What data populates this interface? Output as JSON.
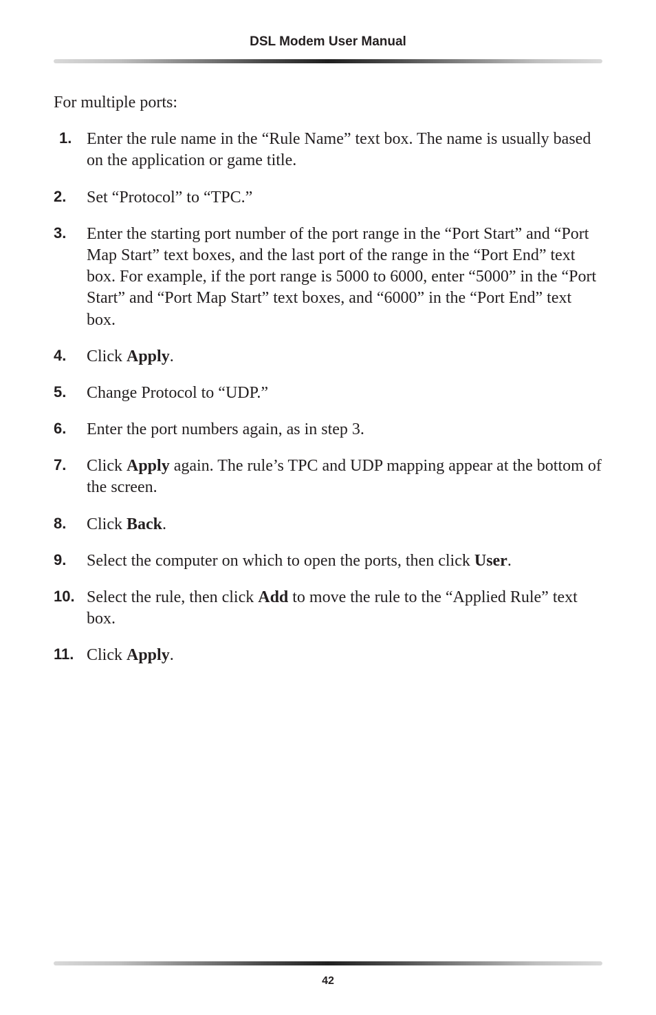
{
  "header": {
    "title": "DSL Modem User Manual"
  },
  "intro": "For multiple ports:",
  "steps": [
    {
      "segments": [
        {
          "text": "Enter the rule name in the “Rule Name” text box. The name is usually based on the application or game title."
        }
      ]
    },
    {
      "segments": [
        {
          "text": "Set “Protocol” to “TPC.”"
        }
      ]
    },
    {
      "segments": [
        {
          "text": "Enter the starting port number of the port range in the “Port Start” and “Port Map Start” text boxes, and the last port of the range in the “Port End” text box. For example, if the port range is 5000 to 6000, enter “5000” in the “Port Start” and “Port Map Start” text boxes, and “6000” in the “Port End” text box."
        }
      ]
    },
    {
      "segments": [
        {
          "text": "Click "
        },
        {
          "text": "Apply",
          "bold": true
        },
        {
          "text": "."
        }
      ]
    },
    {
      "segments": [
        {
          "text": "Change Protocol to “UDP.”"
        }
      ]
    },
    {
      "segments": [
        {
          "text": "Enter the port numbers again, as in step 3."
        }
      ]
    },
    {
      "segments": [
        {
          "text": "Click "
        },
        {
          "text": "Apply",
          "bold": true
        },
        {
          "text": " again. The rule’s TPC and UDP mapping appear at the bottom of the screen."
        }
      ]
    },
    {
      "segments": [
        {
          "text": "Click "
        },
        {
          "text": "Back",
          "bold": true
        },
        {
          "text": "."
        }
      ]
    },
    {
      "segments": [
        {
          "text": "Select the computer on which to open the ports, then click "
        },
        {
          "text": "User",
          "bold": true
        },
        {
          "text": "."
        }
      ]
    },
    {
      "segments": [
        {
          "text": "Select the rule, then click "
        },
        {
          "text": "Add",
          "bold": true
        },
        {
          "text": " to move the rule to the “Applied Rule” text box."
        }
      ]
    },
    {
      "segments": [
        {
          "text": "Click "
        },
        {
          "text": "Apply",
          "bold": true
        },
        {
          "text": "."
        }
      ]
    }
  ],
  "footer": {
    "page_number": "42"
  }
}
